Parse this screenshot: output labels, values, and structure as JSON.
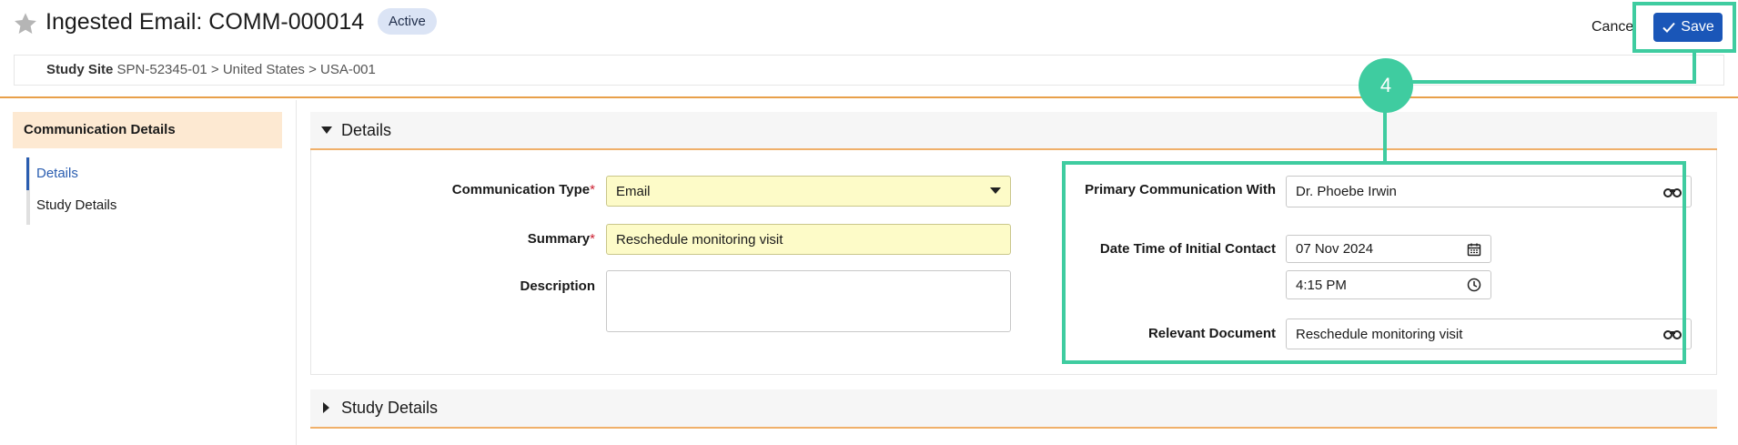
{
  "header": {
    "title": "Ingested Email: COMM-000014",
    "status_badge": "Active",
    "cancel_label": "Cancel",
    "save_label": "Save"
  },
  "breadcrumb": {
    "label": "Study Site",
    "path": "SPN-52345-01 > United States > USA-001"
  },
  "sidebar": {
    "heading": "Communication Details",
    "items": [
      {
        "label": "Details",
        "active": true
      },
      {
        "label": "Study Details",
        "active": false
      }
    ]
  },
  "sections": {
    "details": "Details",
    "study_details": "Study Details"
  },
  "form": {
    "communication_type": {
      "label": "Communication Type",
      "required_mark": "*",
      "value": "Email"
    },
    "summary": {
      "label": "Summary",
      "required_mark": "*",
      "value": "Reschedule monitoring visit"
    },
    "description": {
      "label": "Description",
      "value": ""
    },
    "primary_communication_with": {
      "label": "Primary Communication With",
      "value": "Dr. Phoebe Irwin"
    },
    "date_time_initial_contact": {
      "label": "Date Time of Initial Contact",
      "date": "07 Nov 2024",
      "time": "4:15 PM"
    },
    "relevant_document": {
      "label": "Relevant Document",
      "value": "Reschedule monitoring visit"
    }
  },
  "callout": {
    "number": "4"
  },
  "colors": {
    "accent_blue": "#1a56b8",
    "highlight_green": "#3fcca0",
    "section_orange": "#f0b06a",
    "required_field_yellow": "#fdfbc8"
  },
  "icons": [
    "star-icon",
    "check-icon",
    "caret-down-icon",
    "caret-right-icon",
    "dropdown-arrow-icon",
    "binoculars-icon",
    "calendar-icon",
    "clock-icon"
  ]
}
